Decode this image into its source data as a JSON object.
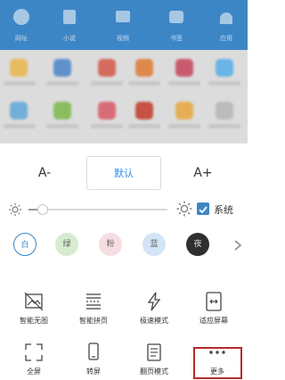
{
  "nav": {
    "items": [
      {
        "label": "网址"
      },
      {
        "label": "小说"
      },
      {
        "label": "视频"
      },
      {
        "label": "书签"
      },
      {
        "label": "应用"
      }
    ]
  },
  "font_size": {
    "decrease_label": "A-",
    "default_label": "默认",
    "increase_label": "A+"
  },
  "brightness": {
    "level": 0.1,
    "follow_system_label": "系统",
    "follow_system_checked": true
  },
  "themes": [
    {
      "label": "白",
      "color": "#ffffff",
      "selected": true
    },
    {
      "label": "绿",
      "color": "#d5ecd0",
      "selected": false
    },
    {
      "label": "粉",
      "color": "#f6dde2",
      "selected": false
    },
    {
      "label": "蓝",
      "color": "#d2e4f6",
      "selected": false
    },
    {
      "label": "夜",
      "color": "#2f2f32",
      "selected": false
    }
  ],
  "tools": [
    {
      "label": "智能无图",
      "icon": "no-image-icon"
    },
    {
      "label": "智能拼页",
      "icon": "page-join-icon"
    },
    {
      "label": "极速模式",
      "icon": "lightning-icon"
    },
    {
      "label": "适应屏幕",
      "icon": "fit-screen-icon"
    },
    {
      "label": "全屏",
      "icon": "fullscreen-icon"
    },
    {
      "label": "转屏",
      "icon": "rotate-screen-icon"
    },
    {
      "label": "翻页模式",
      "icon": "page-flip-icon"
    },
    {
      "label": "更多",
      "icon": "more-icon"
    }
  ],
  "colors": {
    "accent": "#3d86c6",
    "highlight": "#b02c2c"
  }
}
